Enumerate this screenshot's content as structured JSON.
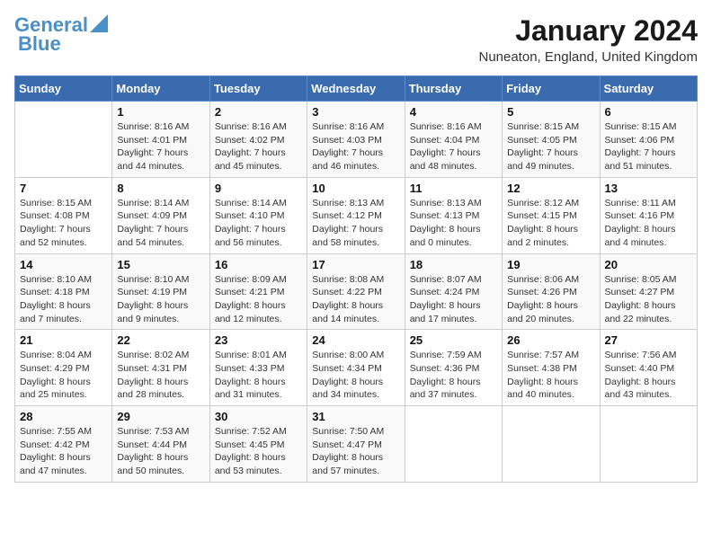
{
  "header": {
    "logo_line1": "General",
    "logo_line2": "Blue",
    "month_year": "January 2024",
    "location": "Nuneaton, England, United Kingdom"
  },
  "weekdays": [
    "Sunday",
    "Monday",
    "Tuesday",
    "Wednesday",
    "Thursday",
    "Friday",
    "Saturday"
  ],
  "weeks": [
    [
      {
        "day": "",
        "info": ""
      },
      {
        "day": "1",
        "info": "Sunrise: 8:16 AM\nSunset: 4:01 PM\nDaylight: 7 hours\nand 44 minutes."
      },
      {
        "day": "2",
        "info": "Sunrise: 8:16 AM\nSunset: 4:02 PM\nDaylight: 7 hours\nand 45 minutes."
      },
      {
        "day": "3",
        "info": "Sunrise: 8:16 AM\nSunset: 4:03 PM\nDaylight: 7 hours\nand 46 minutes."
      },
      {
        "day": "4",
        "info": "Sunrise: 8:16 AM\nSunset: 4:04 PM\nDaylight: 7 hours\nand 48 minutes."
      },
      {
        "day": "5",
        "info": "Sunrise: 8:15 AM\nSunset: 4:05 PM\nDaylight: 7 hours\nand 49 minutes."
      },
      {
        "day": "6",
        "info": "Sunrise: 8:15 AM\nSunset: 4:06 PM\nDaylight: 7 hours\nand 51 minutes."
      }
    ],
    [
      {
        "day": "7",
        "info": "Sunrise: 8:15 AM\nSunset: 4:08 PM\nDaylight: 7 hours\nand 52 minutes."
      },
      {
        "day": "8",
        "info": "Sunrise: 8:14 AM\nSunset: 4:09 PM\nDaylight: 7 hours\nand 54 minutes."
      },
      {
        "day": "9",
        "info": "Sunrise: 8:14 AM\nSunset: 4:10 PM\nDaylight: 7 hours\nand 56 minutes."
      },
      {
        "day": "10",
        "info": "Sunrise: 8:13 AM\nSunset: 4:12 PM\nDaylight: 7 hours\nand 58 minutes."
      },
      {
        "day": "11",
        "info": "Sunrise: 8:13 AM\nSunset: 4:13 PM\nDaylight: 8 hours\nand 0 minutes."
      },
      {
        "day": "12",
        "info": "Sunrise: 8:12 AM\nSunset: 4:15 PM\nDaylight: 8 hours\nand 2 minutes."
      },
      {
        "day": "13",
        "info": "Sunrise: 8:11 AM\nSunset: 4:16 PM\nDaylight: 8 hours\nand 4 minutes."
      }
    ],
    [
      {
        "day": "14",
        "info": "Sunrise: 8:10 AM\nSunset: 4:18 PM\nDaylight: 8 hours\nand 7 minutes."
      },
      {
        "day": "15",
        "info": "Sunrise: 8:10 AM\nSunset: 4:19 PM\nDaylight: 8 hours\nand 9 minutes."
      },
      {
        "day": "16",
        "info": "Sunrise: 8:09 AM\nSunset: 4:21 PM\nDaylight: 8 hours\nand 12 minutes."
      },
      {
        "day": "17",
        "info": "Sunrise: 8:08 AM\nSunset: 4:22 PM\nDaylight: 8 hours\nand 14 minutes."
      },
      {
        "day": "18",
        "info": "Sunrise: 8:07 AM\nSunset: 4:24 PM\nDaylight: 8 hours\nand 17 minutes."
      },
      {
        "day": "19",
        "info": "Sunrise: 8:06 AM\nSunset: 4:26 PM\nDaylight: 8 hours\nand 20 minutes."
      },
      {
        "day": "20",
        "info": "Sunrise: 8:05 AM\nSunset: 4:27 PM\nDaylight: 8 hours\nand 22 minutes."
      }
    ],
    [
      {
        "day": "21",
        "info": "Sunrise: 8:04 AM\nSunset: 4:29 PM\nDaylight: 8 hours\nand 25 minutes."
      },
      {
        "day": "22",
        "info": "Sunrise: 8:02 AM\nSunset: 4:31 PM\nDaylight: 8 hours\nand 28 minutes."
      },
      {
        "day": "23",
        "info": "Sunrise: 8:01 AM\nSunset: 4:33 PM\nDaylight: 8 hours\nand 31 minutes."
      },
      {
        "day": "24",
        "info": "Sunrise: 8:00 AM\nSunset: 4:34 PM\nDaylight: 8 hours\nand 34 minutes."
      },
      {
        "day": "25",
        "info": "Sunrise: 7:59 AM\nSunset: 4:36 PM\nDaylight: 8 hours\nand 37 minutes."
      },
      {
        "day": "26",
        "info": "Sunrise: 7:57 AM\nSunset: 4:38 PM\nDaylight: 8 hours\nand 40 minutes."
      },
      {
        "day": "27",
        "info": "Sunrise: 7:56 AM\nSunset: 4:40 PM\nDaylight: 8 hours\nand 43 minutes."
      }
    ],
    [
      {
        "day": "28",
        "info": "Sunrise: 7:55 AM\nSunset: 4:42 PM\nDaylight: 8 hours\nand 47 minutes."
      },
      {
        "day": "29",
        "info": "Sunrise: 7:53 AM\nSunset: 4:44 PM\nDaylight: 8 hours\nand 50 minutes."
      },
      {
        "day": "30",
        "info": "Sunrise: 7:52 AM\nSunset: 4:45 PM\nDaylight: 8 hours\nand 53 minutes."
      },
      {
        "day": "31",
        "info": "Sunrise: 7:50 AM\nSunset: 4:47 PM\nDaylight: 8 hours\nand 57 minutes."
      },
      {
        "day": "",
        "info": ""
      },
      {
        "day": "",
        "info": ""
      },
      {
        "day": "",
        "info": ""
      }
    ]
  ]
}
